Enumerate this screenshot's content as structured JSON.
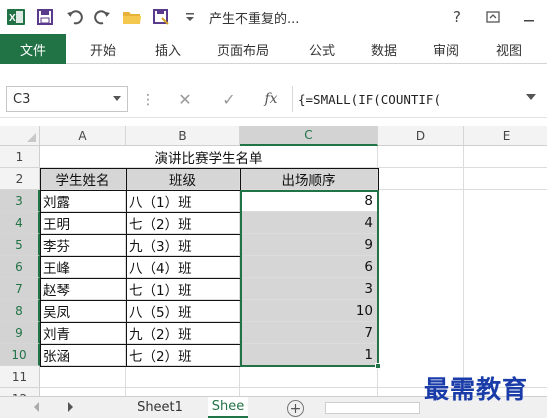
{
  "title_bar": {
    "document_title": "产生不重复的...",
    "help": "?",
    "icons": [
      "excel-logo-icon",
      "save-icon",
      "undo-icon",
      "redo-icon",
      "open-folder-icon",
      "save-as-icon",
      "customize-quick-access-icon",
      "ribbon-display-options-icon",
      "minimize-icon"
    ]
  },
  "ribbon": {
    "file_tab": "文件",
    "tabs": [
      "开始",
      "插入",
      "页面布局",
      "公式",
      "数据",
      "审阅",
      "视图"
    ]
  },
  "formula_bar": {
    "name_box": "C3",
    "fx": "fx",
    "formula": "{=SMALL(IF(COUNTIF("
  },
  "grid": {
    "column_headers": [
      "A",
      "B",
      "C",
      "D",
      "E"
    ],
    "row_headers": [
      "1",
      "2",
      "3",
      "4",
      "5",
      "6",
      "7",
      "8",
      "9",
      "10",
      "11",
      "12"
    ],
    "sheet_title": "演讲比赛学生名单",
    "table_headers": [
      "学生姓名",
      "班级",
      "出场顺序"
    ],
    "rows": [
      {
        "name": "刘露",
        "class": "八（1）班",
        "order": "8"
      },
      {
        "name": "王明",
        "class": "七（2）班",
        "order": "4"
      },
      {
        "name": "李芬",
        "class": "九（3）班",
        "order": "9"
      },
      {
        "name": "王峰",
        "class": "八（4）班",
        "order": "6"
      },
      {
        "name": "赵琴",
        "class": "七（1）班",
        "order": "3"
      },
      {
        "name": "吴凤",
        "class": "八（5）班",
        "order": "10"
      },
      {
        "name": "刘青",
        "class": "九（2）班",
        "order": "7"
      },
      {
        "name": "张涵",
        "class": "七（2）班",
        "order": "1"
      }
    ]
  },
  "sheet_tabs": {
    "tabs": [
      "Sheet1",
      "Shee"
    ],
    "active": "Shee"
  },
  "watermark": "最需教育",
  "colors": {
    "excel_green": "#217346",
    "selection_fill": "#d6d6d6",
    "watermark": "#1a3ca8"
  }
}
